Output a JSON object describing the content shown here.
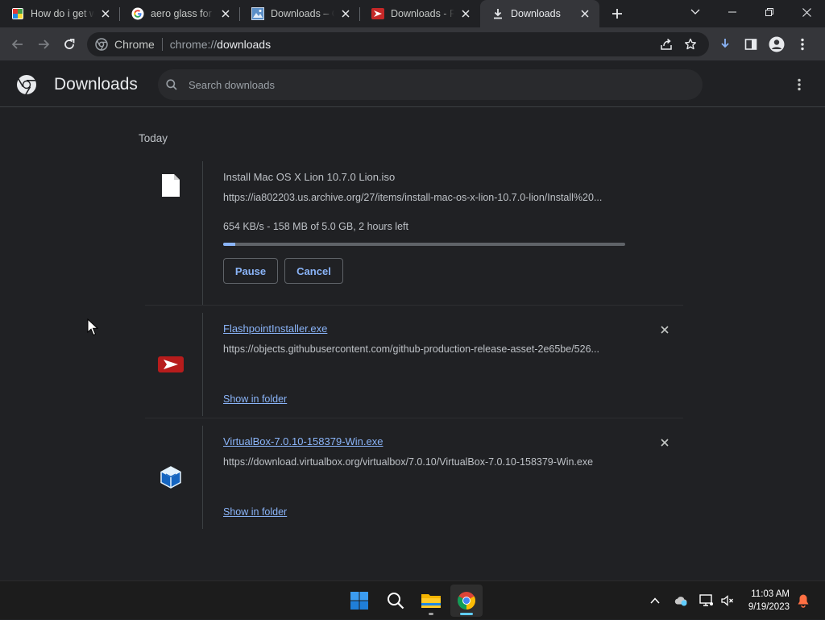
{
  "tabs": [
    {
      "title": "How do i get wi",
      "favicon": "colorful-app-icon",
      "active": false
    },
    {
      "title": "aero glass for w",
      "favicon": "google-icon",
      "active": false
    },
    {
      "title": "Downloads – Or",
      "favicon": "image-thumbnail-icon",
      "active": false
    },
    {
      "title": "Downloads - Fla",
      "favicon": "flashpoint-icon",
      "active": false
    },
    {
      "title": "Downloads",
      "favicon": "download-icon",
      "active": true
    }
  ],
  "omnibox": {
    "site_label": "Chrome",
    "url_scheme": "chrome://",
    "url_host": "downloads"
  },
  "page": {
    "title": "Downloads",
    "search_placeholder": "Search downloads"
  },
  "section_date": "Today",
  "downloads": [
    {
      "filename": "Install Mac OS X Lion 10.7.0 Lion.iso",
      "url": "https://ia802203.us.archive.org/27/items/install-mac-os-x-lion-10.7.0-lion/Install%20...",
      "status": "654 KB/s - 158 MB of 5.0 GB, 2 hours left",
      "progress_fraction": 0.031,
      "pause_label": "Pause",
      "cancel_label": "Cancel",
      "icon": "file-icon",
      "in_progress": true
    },
    {
      "filename": "FlashpointInstaller.exe",
      "url": "https://objects.githubusercontent.com/github-production-release-asset-2e65be/526...",
      "show_in_folder_label": "Show in folder",
      "icon": "flashpoint-icon",
      "in_progress": false
    },
    {
      "filename": "VirtualBox-7.0.10-158379-Win.exe",
      "url": "https://download.virtualbox.org/virtualbox/7.0.10/VirtualBox-7.0.10-158379-Win.exe",
      "show_in_folder_label": "Show in folder",
      "icon": "virtualbox-icon",
      "in_progress": false
    }
  ],
  "taskbar": {
    "apps": [
      "start-icon",
      "search-icon",
      "file-explorer-icon",
      "chrome-icon"
    ],
    "clock_time": "11:03 AM",
    "clock_date": "9/19/2023"
  },
  "colors": {
    "background": "#202124",
    "toolbar": "#35363a",
    "link": "#8ab4f8",
    "text": "#bdc1c6"
  }
}
